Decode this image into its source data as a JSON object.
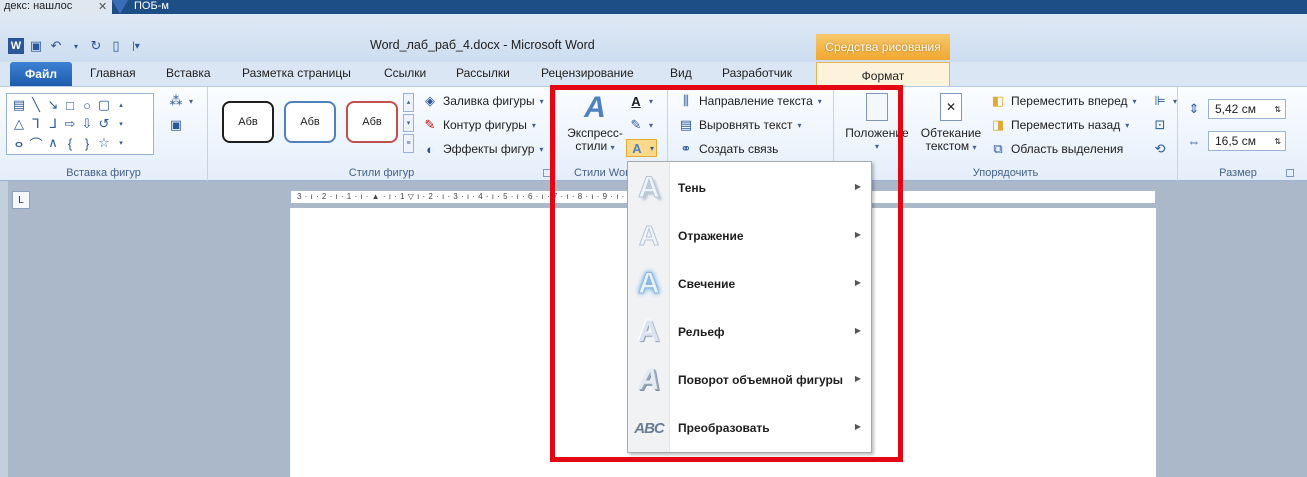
{
  "browser_tabs": [
    {
      "label": "декс: нашлос"
    },
    {
      "label": "ПОБ-м"
    }
  ],
  "window": {
    "title": "Word_лаб_раб_4.docx - Microsoft Word",
    "context_header": "Средства рисования"
  },
  "tabs": {
    "file": "Файл",
    "items": [
      "Главная",
      "Вставка",
      "Разметка страницы",
      "Ссылки",
      "Рассылки",
      "Рецензирование",
      "Вид",
      "Разработчик"
    ],
    "context": "Формат"
  },
  "ribbon": {
    "insert_shapes": {
      "label": "Вставка фигур"
    },
    "shape_styles": {
      "label": "Стили фигур",
      "samples": [
        "Абв",
        "Абв",
        "Абв"
      ],
      "fill": "Заливка фигуры",
      "outline": "Контур фигуры",
      "effects": "Эффекты фигур"
    },
    "wordart": {
      "label": "Стили WordArt",
      "express_line1": "Экспресс-",
      "express_line2": "стили"
    },
    "text": {
      "direction": "Направление текста",
      "align": "Выровнять текст",
      "link": "Создать связь"
    },
    "arrange": {
      "label": "Упорядочить",
      "position": "Положение",
      "wrap_line1": "Обтекание",
      "wrap_line2": "текстом",
      "forward": "Переместить вперед",
      "backward": "Переместить назад",
      "selection": "Область выделения"
    },
    "size": {
      "label": "Размер",
      "height": "5,42 см",
      "width": "16,5 см"
    }
  },
  "ruler": {
    "text": "3 · ı · 2 · ı · 1 · ı · ▲ · ı · 1 ▽ ı · 2 · ı · 3 · ı · 4 · ı · 5 · ı · 6 · ı · 7 · ı · 8 · ı · 9 · ı · 10 · ı · 11 · ı · 12 · ı · 13 · ı · 14 · ı · 15 · ı · ▲ · ı · 17 · ı",
    "corner": "L"
  },
  "menu": {
    "items": [
      {
        "label": "Тень"
      },
      {
        "label": "Отражение"
      },
      {
        "label": "Свечение"
      },
      {
        "label": "Рельеф"
      },
      {
        "label": "Поворот объемной фигуры"
      },
      {
        "label": "Преобразовать"
      }
    ]
  },
  "colors": {
    "highlight": "#e30613",
    "accent": "#2b579a",
    "context": "#f0a830"
  }
}
